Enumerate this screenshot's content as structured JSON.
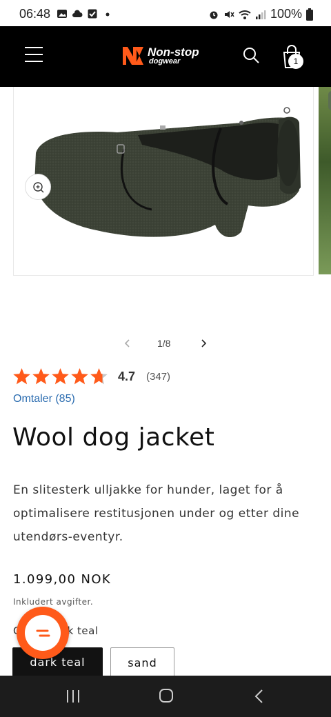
{
  "status_bar": {
    "time": "06:48",
    "battery": "100%",
    "left_icons": [
      "image-icon",
      "cloud-icon",
      "check-icon",
      "dot-icon"
    ],
    "right_icons": [
      "alarm-icon",
      "mute-icon",
      "wifi-icon",
      "signal-icon",
      "battery-icon"
    ]
  },
  "header": {
    "logo_main": "Non-stop",
    "logo_sub": "dogwear",
    "cart_count": "1",
    "brand_color": "#ff5a1a"
  },
  "gallery": {
    "counter": "1/8",
    "product_color": "#3c4236"
  },
  "rating": {
    "value": "4.7",
    "count": "(347)",
    "stars": 4.7,
    "star_color": "#ff5a1a",
    "reviews_link": "Omtaler (85)"
  },
  "product": {
    "title": "Wool dog jacket",
    "description": "En slitesterk ulljakke for hunder, laget for å optimalisere restitusjonen under og etter dine utendørs-eventyr.",
    "price": "1.099,00 NOK",
    "tax_note": "Inkludert avgifter.",
    "color_label": "Color: dark teal",
    "swatches": [
      "dark teal",
      "sand"
    ],
    "selected_swatch": "dark teal"
  }
}
